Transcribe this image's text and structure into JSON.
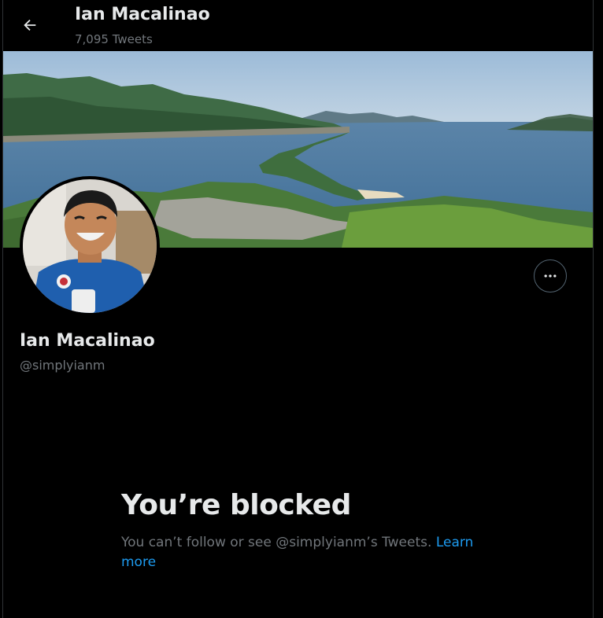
{
  "header": {
    "name": "Ian Macalinao",
    "tweet_count": "7,095 Tweets"
  },
  "profile": {
    "name": "Ian Macalinao",
    "handle": "@simplyianm"
  },
  "blocked": {
    "title": "You’re blocked",
    "message": "You can’t follow or see @simplyianm’s Tweets. ",
    "link": "Learn more"
  },
  "colors": {
    "background": "#000000",
    "primary_text": "#e7e9ea",
    "secondary_text": "#71767b",
    "link": "#1d9bf0"
  },
  "icons": {
    "back": "arrow-left-icon",
    "more": "more-horizontal-icon"
  }
}
